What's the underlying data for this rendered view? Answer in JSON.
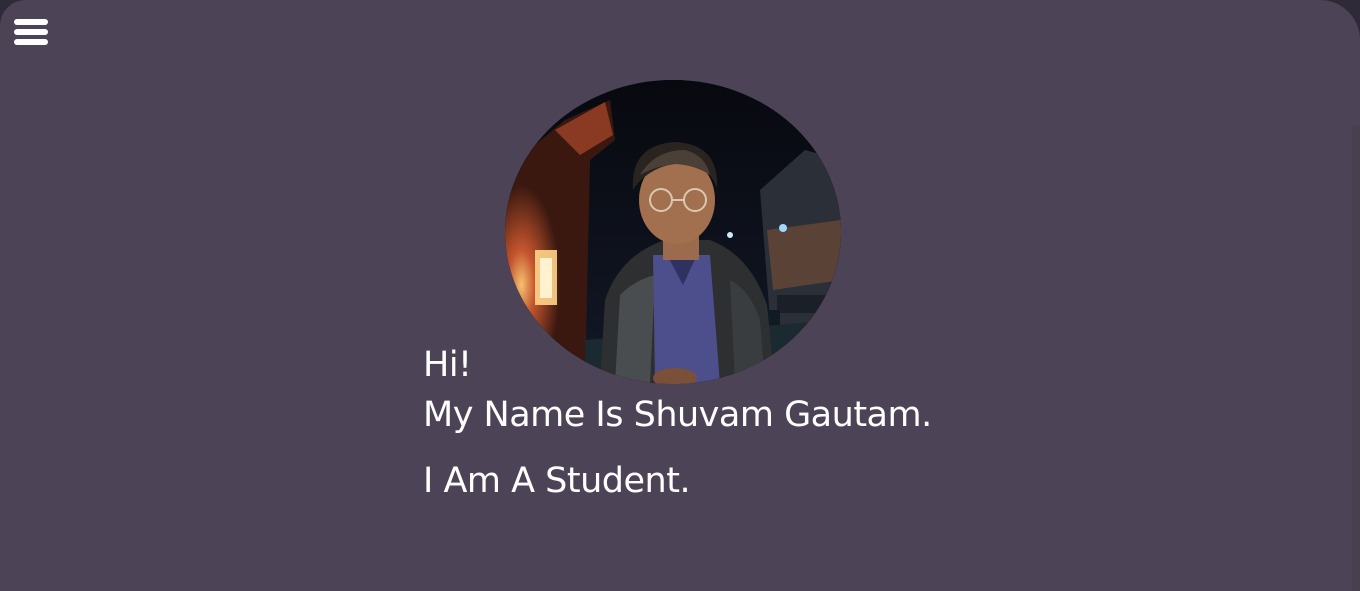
{
  "nav": {
    "menu_icon": "hamburger-menu-icon"
  },
  "profile": {
    "photo": "profile-photo",
    "greeting": "Hi!",
    "name_line": "My Name Is Shuvam Gautam.",
    "role_line": "I Am A Student."
  },
  "colors": {
    "background": "#4d4357",
    "text": "#ffffff"
  }
}
